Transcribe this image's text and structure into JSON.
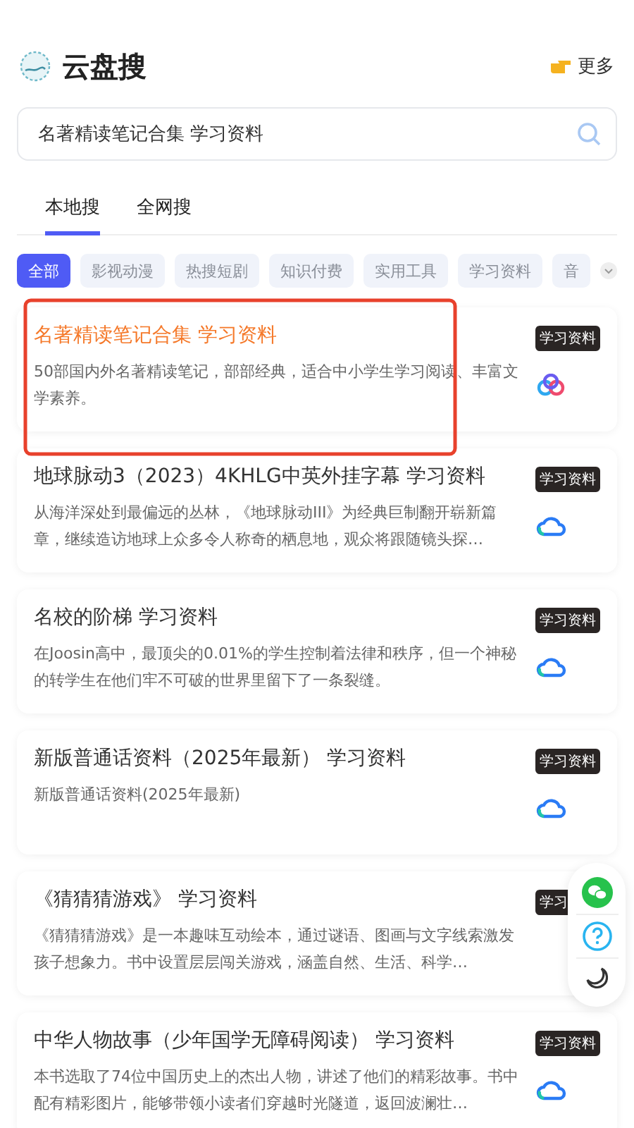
{
  "header": {
    "title": "云盘搜",
    "more": "更多"
  },
  "search": {
    "value": "名著精读笔记合集 学习资料"
  },
  "tabs": [
    {
      "label": "本地搜",
      "selected": true
    },
    {
      "label": "全网搜",
      "selected": false
    }
  ],
  "chips": [
    {
      "label": "全部",
      "selected": true
    },
    {
      "label": "影视动漫",
      "selected": false
    },
    {
      "label": "热搜短剧",
      "selected": false
    },
    {
      "label": "知识付费",
      "selected": false
    },
    {
      "label": "实用工具",
      "selected": false
    },
    {
      "label": "学习资料",
      "selected": false
    },
    {
      "label": "音",
      "selected": false
    }
  ],
  "results": [
    {
      "title": "名著精读笔记合集 学习资料",
      "highlighted": true,
      "desc": "50部国内外名著精读笔记，部部经典，适合中小学生学习阅读、丰富文学素养。",
      "tag": "学习资料",
      "kind": "rings"
    },
    {
      "title": "地球脉动3（2023）4KHLG中英外挂字幕 学习资料",
      "highlighted": false,
      "desc": "从海洋深处到最偏远的丛林，《地球脉动III》为经典巨制翻开崭新篇章，继续造访地球上众多令人称奇的栖息地，观众将跟随镜头探…",
      "tag": "学习资料",
      "kind": "cloud"
    },
    {
      "title": "名校的阶梯 学习资料",
      "highlighted": false,
      "desc": "在Joosin高中，最顶尖的0.01%的学生控制着法律和秩序，但一个神秘的转学生在他们牢不可破的世界里留下了一条裂缝。",
      "tag": "学习资料",
      "kind": "cloud"
    },
    {
      "title": "新版普通话资料（2025年最新） 学习资料",
      "highlighted": false,
      "desc": "新版普通话资料(2025年最新)",
      "tag": "学习资料",
      "kind": "cloud"
    },
    {
      "title": "《猜猜猜游戏》 学习资料",
      "highlighted": false,
      "desc": "《猜猜猜游戏》是一本趣味互动绘本，通过谜语、图画与文字线索激发孩子想象力。书中设置层层闯关游戏，涵盖自然、生活、科学…",
      "tag": "学习"
    },
    {
      "title": "中华人物故事（少年国学无障碍阅读） 学习资料",
      "highlighted": false,
      "desc": "本书选取了74位中国历史上的杰出人物，讲述了他们的精彩故事。书中配有精彩图片，能够带领小读者们穿越时光隧道，返回波澜壮…",
      "tag": "学习资料",
      "kind": "cloud"
    }
  ],
  "float_buttons": [
    {
      "kind": "wechat"
    },
    {
      "kind": "help"
    },
    {
      "kind": "moon"
    }
  ],
  "annotations": [
    {
      "kind": "box"
    }
  ]
}
